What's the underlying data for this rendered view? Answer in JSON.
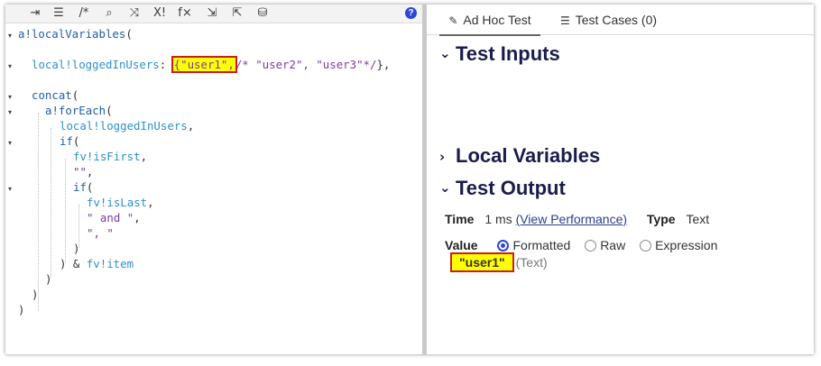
{
  "toolbar": {
    "icons": [
      "indent-icon",
      "outdent-icon",
      "comment-icon",
      "search-icon",
      "shuffle-icon",
      "function-icon",
      "formula-icon",
      "collapse-icon",
      "export-icon",
      "database-icon"
    ],
    "glyphs": [
      "⇥",
      "☰",
      "/*",
      "⌕",
      "⤨",
      "X!",
      "f×",
      "⇲",
      "⇱",
      "⛁"
    ],
    "help": "?"
  },
  "code": {
    "l1_fn": "a!localVariables",
    "l1_p": "(",
    "l3_var": "local!loggedInUsers",
    "l3_colon": ": ",
    "l3_hl": "{\"user1\",",
    "l3_cm": "/* \"user2\", \"user3\"*/",
    "l3_end": "},",
    "l5_fn": "concat",
    "l5_p": "(",
    "l6_fn": "a!forEach",
    "l6_p": "(",
    "l7_var": "local!loggedInUsers",
    "l7_end": ",",
    "l8_fn": "if",
    "l8_p": "(",
    "l9_var": "fv!isFirst",
    "l9_end": ",",
    "l10_str": "\"\"",
    "l10_end": ",",
    "l11_fn": "if",
    "l11_p": "(",
    "l12_var": "fv!isLast",
    "l12_end": ",",
    "l13_str": "\" and \"",
    "l13_end": ",",
    "l14_str": "\", \"",
    "l15_p": ")",
    "l16_p": ") & ",
    "l16_var": "fv!item",
    "l17_p": ")",
    "l18_p": ")",
    "l19_p": ")"
  },
  "panel": {
    "tab_adhoc": "Ad Hoc Test",
    "tab_cases": "Test Cases (0)",
    "test_inputs": "Test Inputs",
    "local_variables": "Local Variables",
    "test_output": "Test Output",
    "time_label": "Time",
    "time_value": "1 ms",
    "view_performance": "(View Performance)",
    "type_label": "Type",
    "type_value": "Text",
    "value_label": "Value",
    "opt_formatted": "Formatted",
    "opt_raw": "Raw",
    "opt_expression": "Expression",
    "result_value": "\"user1\"",
    "result_type": "(Text)"
  },
  "colors": {
    "accent": "#2c46d6",
    "heading": "#1a1c4c",
    "highlight": "#ffff00",
    "highlight_border": "#c91d1d"
  }
}
